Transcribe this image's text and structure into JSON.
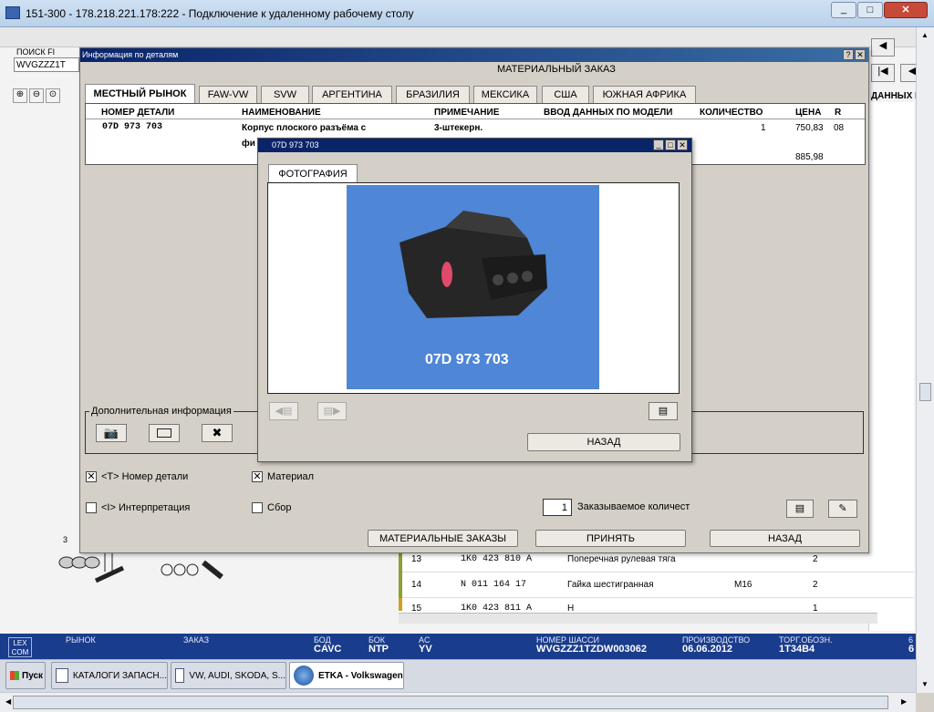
{
  "rdp": {
    "title": "151-300 - 178.218.221.178:222 - Подключение к удаленному рабочему столу"
  },
  "bg": {
    "search_label": "ПОИСК FI",
    "search_value": "WVGZZZ1T",
    "right_header": "ДАННЫХ П",
    "rows": [
      {
        "n": "13",
        "code": "1K0 423 810 A",
        "name": "Поперечная рулевая тяга",
        "qty": "2",
        "extra": ""
      },
      {
        "n": "14",
        "code": "N 011 164 17",
        "name": "Гайка шестигранная",
        "qty": "2",
        "extra": "M16"
      },
      {
        "n": "15",
        "code": "1K0 423 811 A",
        "name": "Н",
        "qty": "1",
        "extra": ""
      }
    ],
    "diagram_number": "3"
  },
  "dialog": {
    "title": "Информация по деталям",
    "subtitle": "МАТЕРИАЛЬНЫЙ ЗАКАЗ",
    "tabs": [
      "МЕСТНЫЙ РЫНОК",
      "FAW-VW",
      "SVW",
      "АРГЕНТИНА",
      "БРАЗИЛИЯ",
      "МЕКСИКА",
      "США",
      "ЮЖНАЯ АФРИКА"
    ],
    "columns": [
      "НОМЕР ДЕТАЛИ",
      "НАИМЕНОВАНИЕ",
      "ПРИМЕЧАНИЕ",
      "ВВОД ДАННЫХ ПО МОДЕЛИ",
      "КОЛИЧЕСТВО",
      "ЦЕНА",
      "R"
    ],
    "row": {
      "part": "07D 973 703",
      "name1": "Корпус плоского разъёма с",
      "name2": "фи",
      "note": "3-штекерн.",
      "qty": "1",
      "price": "750,83",
      "r": "08",
      "price2": "885,98"
    },
    "extra_info": "Дополнительная информация",
    "cb_part": "<T> Номер детали",
    "cb_material": "Материал",
    "cb_interp": "<I> Интерпретация",
    "cb_assembly": "Сбор",
    "order_qty": "1",
    "order_qty_label": "Заказываемое количест",
    "btn_orders": "МАТЕРИАЛЬНЫЕ ЗАКАЗЫ",
    "btn_accept": "ПРИНЯТЬ",
    "btn_back": "НАЗАД"
  },
  "photo": {
    "title": "07D 973 703",
    "tab": "ФОТОГРАФИЯ",
    "image_caption": "07D 973 703",
    "btn_back": "НАЗАД"
  },
  "status": {
    "items": [
      {
        "label": "РЫНОК",
        "value": ""
      },
      {
        "label": "ЗАКАЗ",
        "value": ""
      },
      {
        "label": "БОД",
        "value": "CAVC"
      },
      {
        "label": "БОК",
        "value": "NTP"
      },
      {
        "label": "AC",
        "value": "YV"
      },
      {
        "label": "НОМЕР ШАССИ",
        "value": "WVGZZZ1TZDW003062"
      },
      {
        "label": "ПРОИЗВОДСТВО",
        "value": "06.06.2012"
      },
      {
        "label": "ТОРГ.ОБОЗН.",
        "value": "1T34B4"
      },
      {
        "label": "6",
        "value": "6"
      }
    ],
    "logo_top": "LEX",
    "logo_bottom": "COM"
  },
  "taskbar": {
    "start": "Пуск",
    "items": [
      "КАТАЛОГИ ЗАПАСН...",
      "VW, AUDI, SKODA, S...",
      "ETKA - Volkswagen"
    ]
  },
  "colors": {
    "statusbar": "#1a3c8c",
    "dialog_title": "#0a246a",
    "photo_bg": "#4f86d6"
  }
}
